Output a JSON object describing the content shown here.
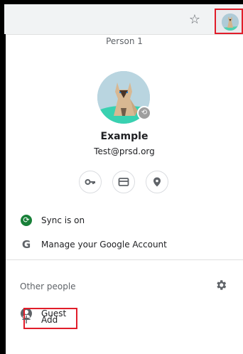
{
  "toolbar": {
    "bookmark_icon": "star-icon",
    "profile_icon": "profile-avatar-icon"
  },
  "menu": {
    "person_label": "Person 1",
    "profile_name": "Example",
    "email": "Test@prsd.org",
    "actions": [
      {
        "name": "passwords",
        "icon": "key-icon"
      },
      {
        "name": "payment-methods",
        "icon": "card-icon"
      },
      {
        "name": "addresses",
        "icon": "location-icon"
      }
    ],
    "sync_label": "Sync is on",
    "manage_account_label": "Manage your Google Account",
    "other_people_label": "Other people",
    "guest_label": "Guest",
    "add_label": "Add"
  },
  "colors": {
    "highlight": "#e11d2a",
    "sync_green": "#188038",
    "text_muted": "#5f6368"
  }
}
